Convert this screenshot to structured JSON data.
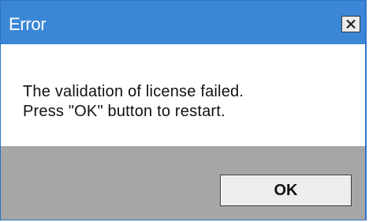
{
  "window": {
    "title": "Error",
    "close_glyph": "✕",
    "close_icon": "close-icon"
  },
  "dialog": {
    "message_line1": "The validation of license failed.",
    "message_line2": "Press \"OK\" button to restart."
  },
  "footer": {
    "ok_label": "OK"
  },
  "colors": {
    "titlebar": "#3b86d6",
    "footer": "#a6a6a6",
    "button": "#ededed"
  }
}
